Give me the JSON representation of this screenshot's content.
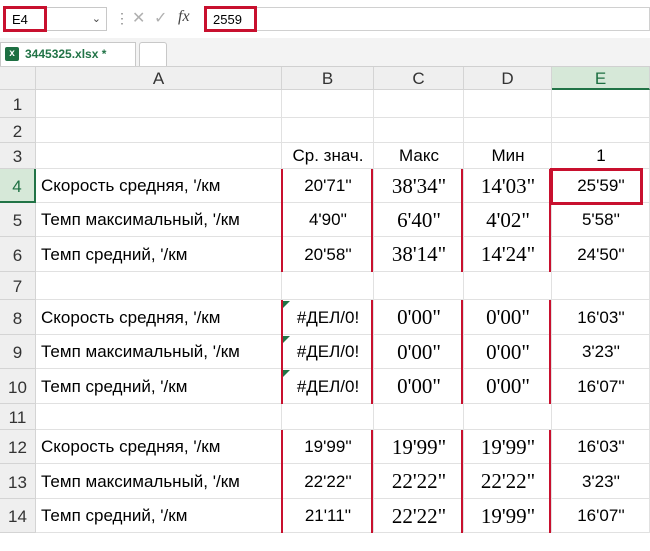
{
  "formula_bar": {
    "name_box": "E4",
    "formula_value": "2559",
    "cancel_glyph": "✕",
    "enter_glyph": "✓",
    "fx_glyph": "fx"
  },
  "tabs": {
    "file_tab_label": "3445325.xlsx *"
  },
  "columns": [
    "A",
    "B",
    "C",
    "D",
    "E"
  ],
  "rows": [
    "1",
    "2",
    "3",
    "4",
    "5",
    "6",
    "7",
    "8",
    "9",
    "10",
    "11",
    "12",
    "13",
    "14"
  ],
  "cells": {
    "r3": {
      "B": "Ср. знач.",
      "C": "Макс",
      "D": "Мин",
      "E": "1"
    },
    "r4": {
      "A": "Скорость средняя, '/км",
      "B": "20'71''",
      "C": "38'34\"",
      "D": "14'03\"",
      "E": "25'59''"
    },
    "r5": {
      "A": "Темп максимальный, '/км",
      "B": "4'90''",
      "C": "6'40\"",
      "D": "4'02\"",
      "E": "5'58''"
    },
    "r6": {
      "A": "Темп средний, '/км",
      "B": "20'58''",
      "C": "38'14\"",
      "D": "14'24\"",
      "E": "24'50''"
    },
    "r8": {
      "A": "Скорость средняя, '/км",
      "B": "#ДЕЛ/0!",
      "C": "0'00\"",
      "D": "0'00\"",
      "E": "16'03''"
    },
    "r9": {
      "A": "Темп максимальный, '/км",
      "B": "#ДЕЛ/0!",
      "C": "0'00\"",
      "D": "0'00\"",
      "E": "3'23''"
    },
    "r10": {
      "A": "Темп средний, '/км",
      "B": "#ДЕЛ/0!",
      "C": "0'00\"",
      "D": "0'00\"",
      "E": "16'07''"
    },
    "r12": {
      "A": "Скорость средняя, '/км",
      "B": "19'99''",
      "C": "19'99\"",
      "D": "19'99\"",
      "E": "16'03''"
    },
    "r13": {
      "A": "Темп максимальный, '/км",
      "B": "22'22''",
      "C": "22'22\"",
      "D": "22'22\"",
      "E": "3'23''"
    },
    "r14": {
      "A": "Темп средний, '/км",
      "B": "21'11''",
      "C": "22'22\"",
      "D": "19'99\"",
      "E": "16'07''"
    }
  },
  "colors": {
    "highlight_red": "#c8102e",
    "excel_green": "#217346"
  }
}
